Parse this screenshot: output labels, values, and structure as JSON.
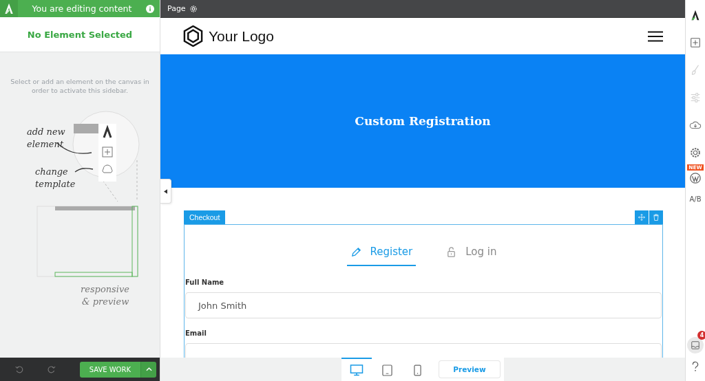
{
  "editor_bar": {
    "title": "You are editing content",
    "page_label": "Page"
  },
  "sidebar": {
    "heading": "No Element Selected",
    "hint": "Select or add an element on the canvas in order to activate this sidebar.",
    "callouts": [
      "add new element",
      "change template",
      "responsive & preview"
    ],
    "save_button": "SAVE WORK"
  },
  "site": {
    "logo": "Your Logo",
    "hero_title": "Custom Registration"
  },
  "element": {
    "label": "Checkout",
    "tabs": [
      {
        "label": "Register",
        "selected": true
      },
      {
        "label": "Log in",
        "selected": false
      }
    ],
    "fields": [
      {
        "label": "Full Name",
        "value": "John Smith"
      },
      {
        "label": "Email"
      }
    ]
  },
  "devices": [
    {
      "kind": "desktop",
      "selected": true
    },
    {
      "kind": "tablet",
      "selected": false
    },
    {
      "kind": "phone",
      "selected": false
    }
  ],
  "preview_button": "Preview",
  "rail": {
    "new_badge": "NEW",
    "ab_label": "A/B",
    "inbox_count": "4"
  }
}
